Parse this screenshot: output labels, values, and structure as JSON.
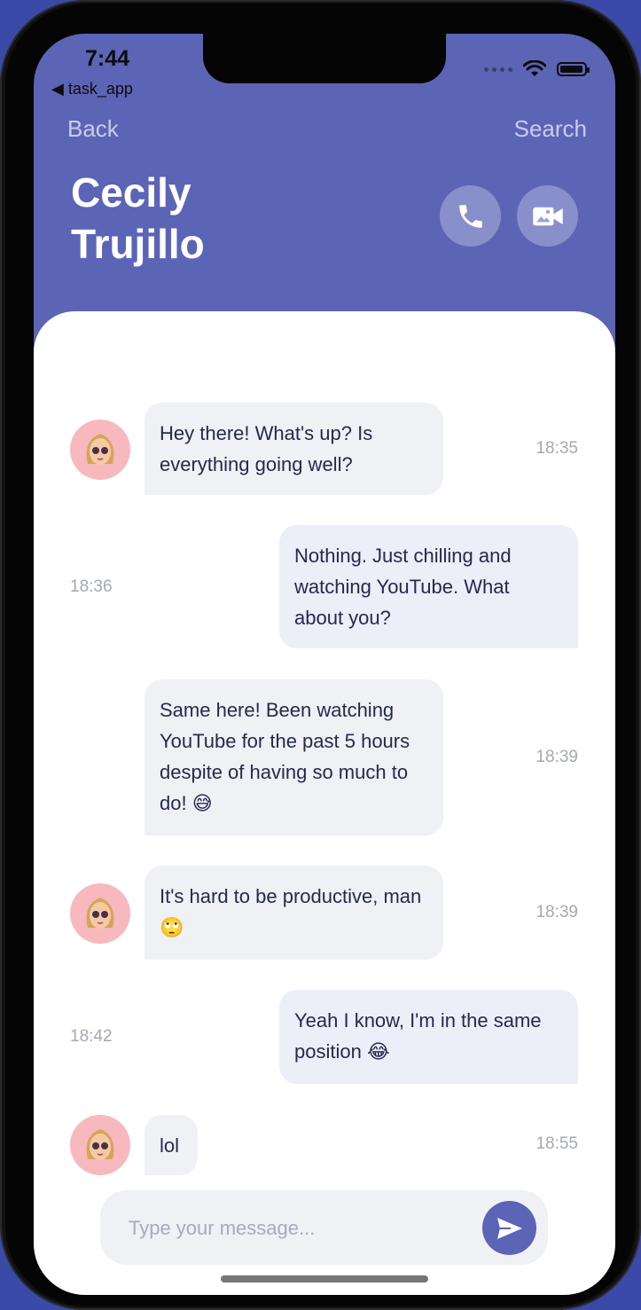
{
  "status_bar": {
    "time": "7:44",
    "back_app": "◀ task_app"
  },
  "nav": {
    "back": "Back",
    "search": "Search"
  },
  "contact": {
    "name": "Cecily Trujillo"
  },
  "messages": [
    {
      "side": "in",
      "text": "Hey there! What's up? Is everything going well?",
      "time": "18:35"
    },
    {
      "side": "out",
      "text": "Nothing. Just chilling and watching YouTube. What about you?",
      "time": "18:36"
    },
    {
      "side": "in",
      "text": "Same here! Been watching YouTube for the past 5 hours despite of having so much to do! 😅",
      "time": "18:39"
    },
    {
      "side": "in",
      "text": "It's hard to be productive, man 🙄",
      "time": "18:39"
    },
    {
      "side": "out",
      "text": "Yeah I know, I'm in the same position 😂",
      "time": "18:42"
    },
    {
      "side": "in",
      "text": "lol",
      "time": "18:55"
    }
  ],
  "composer": {
    "placeholder": "Type your message..."
  },
  "colors": {
    "accent": "#5c64b6",
    "incoming_bubble": "#f0f1f5",
    "outgoing_bubble": "#eceef8",
    "avatar_bg": "#f7b9be"
  }
}
